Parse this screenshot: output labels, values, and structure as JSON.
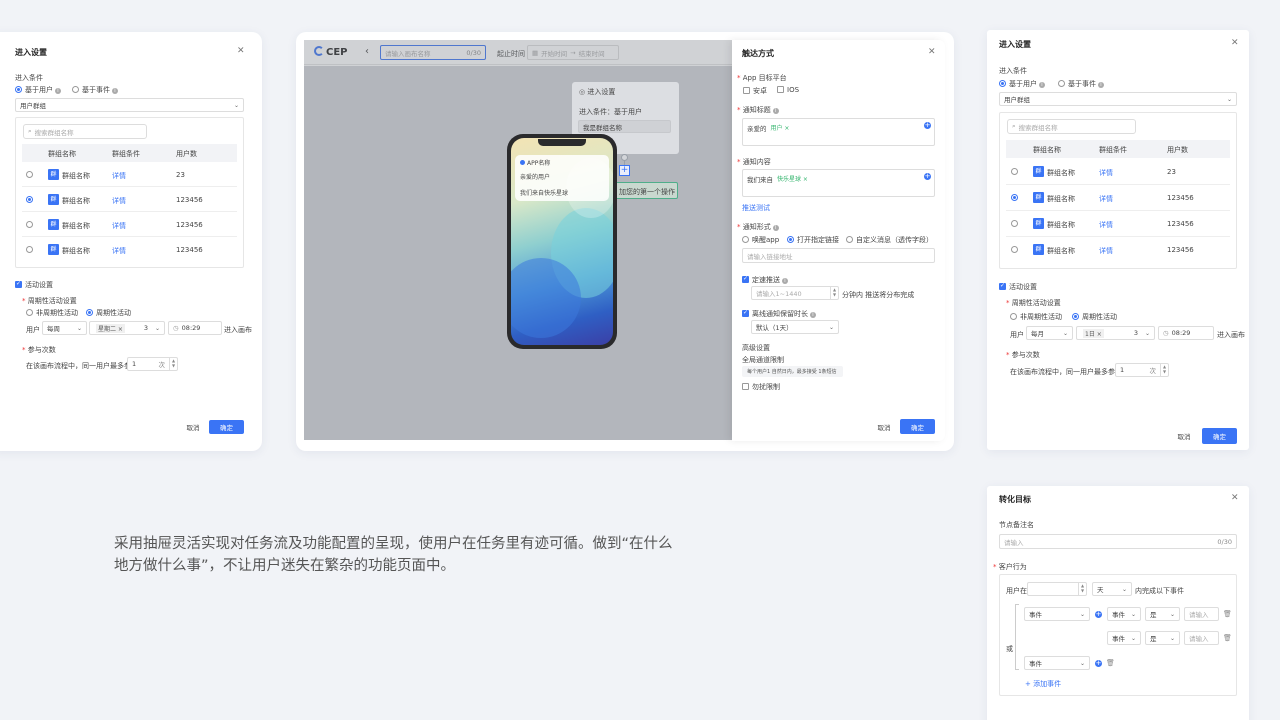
{
  "p1": {
    "title": "进入设置",
    "cond_label": "进入条件",
    "opt_user": "基于用户",
    "opt_event": "基于事件",
    "select": "用户群组",
    "search": "搜索群组名称",
    "cols": [
      "群组名称",
      "群组条件",
      "用户数"
    ],
    "rows": [
      {
        "name": "群组名称",
        "cond": "详情",
        "n": "23"
      },
      {
        "name": "群组名称",
        "cond": "详情",
        "n": "123456"
      },
      {
        "name": "群组名称",
        "cond": "详情",
        "n": "123456"
      },
      {
        "name": "群组名称",
        "cond": "详情",
        "n": "123456"
      }
    ],
    "icon": "群",
    "activity": "活动设置",
    "periodic_label": "周期性活动设置",
    "non_periodic": "非周期性活动",
    "periodic": "周期性活动",
    "user_lbl": "用户",
    "freq": "每周",
    "day_tag": "星期二",
    "count": "3",
    "time": "08:29",
    "enter": "进入画布",
    "part_label": "参与次数",
    "part_text": "在该画布流程中，同一用户最多参与",
    "part_num": "1",
    "part_unit": "次",
    "cancel": "取消",
    "ok": "确定"
  },
  "center": {
    "logo": "CEP",
    "back": "‹",
    "name_ph": "请输入画布名称",
    "name_cnt": "0/30",
    "start_lbl": "起止时间",
    "start_ph": "开始时间",
    "sep": "→",
    "end_ph": "结束时间",
    "node_title": "进入设置",
    "node_cond": "进入条件：基于用户",
    "node_group": "我是群组名称",
    "add_action": "加您的第一个操作",
    "phone": {
      "app": "APP名称",
      "line1": "亲爱的用户",
      "line2": "我们来自快乐星球"
    }
  },
  "drawer": {
    "title": "触达方式",
    "platform": "App 目标平台",
    "android": "安卓",
    "ios": "IOS",
    "notif_title": "通知标题",
    "title_text": "亲爱的",
    "title_tag": "用户",
    "notif_content": "通知内容",
    "content_text": "我们来自",
    "content_tag": "快乐星球",
    "push_test": "推送测试",
    "form_label": "通知形式",
    "f1": "唤醒app",
    "f2": "打开指定链接",
    "f3": "自定义消息（透传字段）",
    "link_ph": "请输入链接地址",
    "timed": "定速推送",
    "timed_ph": "请输入1~1440",
    "timed_tail": "分钟内 推送将分布完成",
    "retain": "离线通知保留时长",
    "retain_val": "默认（1天）",
    "adv": "高级设置",
    "global": "全局通道限制",
    "global_desc": "每个用户1 自然日内，最多接受 1条短信",
    "no_disturb": "勿扰限制",
    "cancel": "取消",
    "ok": "确定"
  },
  "p3": {
    "title": "进入设置",
    "cond_label": "进入条件",
    "opt_user": "基于用户",
    "opt_event": "基于事件",
    "select": "用户群组",
    "search": "搜索群组名称",
    "cols": [
      "群组名称",
      "群组条件",
      "用户数"
    ],
    "rows": [
      {
        "name": "群组名称",
        "cond": "详情",
        "n": "23"
      },
      {
        "name": "群组名称",
        "cond": "详情",
        "n": "123456"
      },
      {
        "name": "群组名称",
        "cond": "详情",
        "n": "123456"
      },
      {
        "name": "群组名称",
        "cond": "详情",
        "n": "123456"
      }
    ],
    "icon": "群",
    "activity": "活动设置",
    "periodic_label": "周期性活动设置",
    "non_periodic": "非周期性活动",
    "periodic": "周期性活动",
    "user_lbl": "用户",
    "freq": "每月",
    "day_tag": "1日",
    "count": "3",
    "time": "08:29",
    "enter": "进入画布",
    "part_label": "参与次数",
    "part_text": "在该画布流程中，同一用户最多参与",
    "part_num": "1",
    "part_unit": "次",
    "cancel": "取消",
    "ok": "确定"
  },
  "p4": {
    "title": "转化目标",
    "note_label": "节点备注名",
    "note_ph": "请输入",
    "note_cnt": "0/30",
    "behav": "客户行为",
    "user_in": "用户在",
    "unit": "天",
    "tail": "内完成以下事件",
    "or": "或",
    "ev": "事件",
    "is": "是",
    "val_ph": "请输入",
    "add": "添加事件"
  },
  "caption": {
    "line1": "采用抽屉灵活实现对任务流及功能配置的呈现，使用户在任务里有迹可循。做到“在什么",
    "line2": "地方做什么事”，不让用户迷失在繁杂的功能页面中。"
  }
}
